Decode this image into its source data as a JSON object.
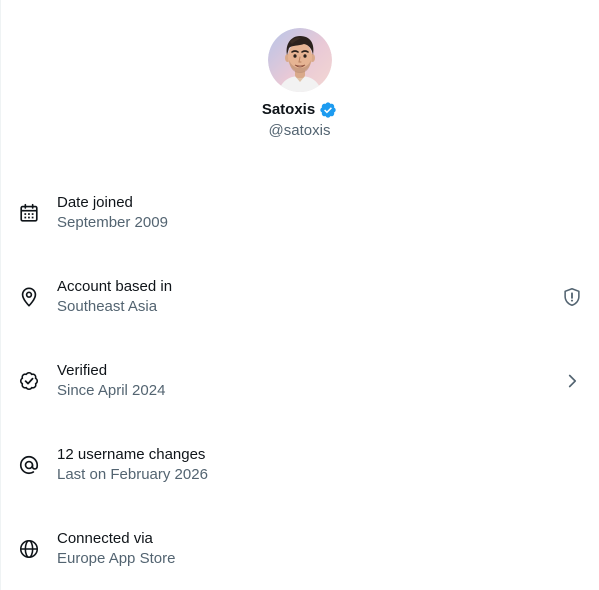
{
  "profile": {
    "display_name": "Satoxis",
    "handle": "@satoxis",
    "verified": true,
    "badge_color": "#1d9bf0"
  },
  "rows": [
    {
      "icon": "calendar-icon",
      "title": "Date joined",
      "subtitle": "September 2009"
    },
    {
      "icon": "location-pin-icon",
      "title": "Account based in",
      "subtitle": "Southeast Asia",
      "trailing_icon": "shield-info-icon"
    },
    {
      "icon": "verified-check-icon",
      "title": "Verified",
      "subtitle": "Since April 2024",
      "trailing_icon": "chevron-right-icon"
    },
    {
      "icon": "at-sign-icon",
      "title": "12 username changes",
      "subtitle": "Last on February 2026"
    },
    {
      "icon": "globe-icon",
      "title": "Connected via",
      "subtitle": "Europe App Store"
    }
  ],
  "colors": {
    "text_primary": "#0f1419",
    "text_secondary": "#536471",
    "accent": "#1d9bf0"
  }
}
